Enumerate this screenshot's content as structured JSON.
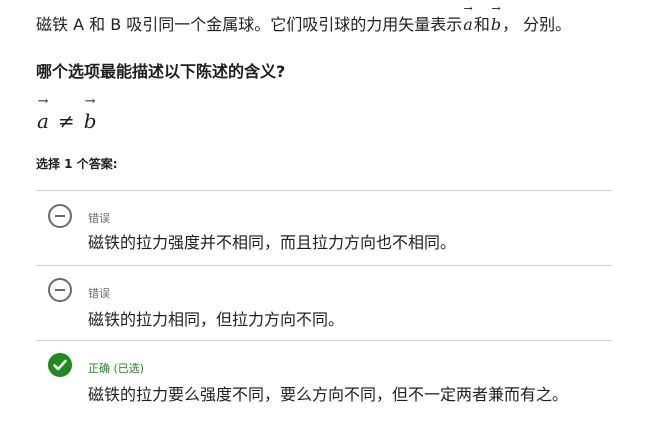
{
  "intro": {
    "prefix": "磁铁 A 和 B 吸引同一个金属球。它们吸引球的力用矢量表示",
    "vec_a": "a",
    "joiner": "和",
    "vec_b": "b",
    "suffix": "， 分别。",
    "arrow": "→"
  },
  "question": "哪个选项最能描述以下陈述的含义?",
  "math": {
    "left": "a",
    "op": "≠",
    "right": "b",
    "arrow": "→"
  },
  "instruction": "选择 1 个答案:",
  "options": [
    {
      "status": "错误",
      "icon": "minus-circle-icon",
      "text": "磁铁的拉力强度并不相同，而且拉力方向也不相同。"
    },
    {
      "status": "错误",
      "icon": "minus-circle-icon",
      "text": "磁铁的拉力相同，但拉力方向不同。"
    },
    {
      "status": "正确 (已选)",
      "icon": "check-circle-icon",
      "text": "磁铁的拉力要么强度不同，要么方向不同，但不一定两者兼而有之。"
    }
  ],
  "colors": {
    "correct": "#1f8a1f",
    "neutral": "#6b6b6b",
    "divider": "#d0d0d0"
  }
}
